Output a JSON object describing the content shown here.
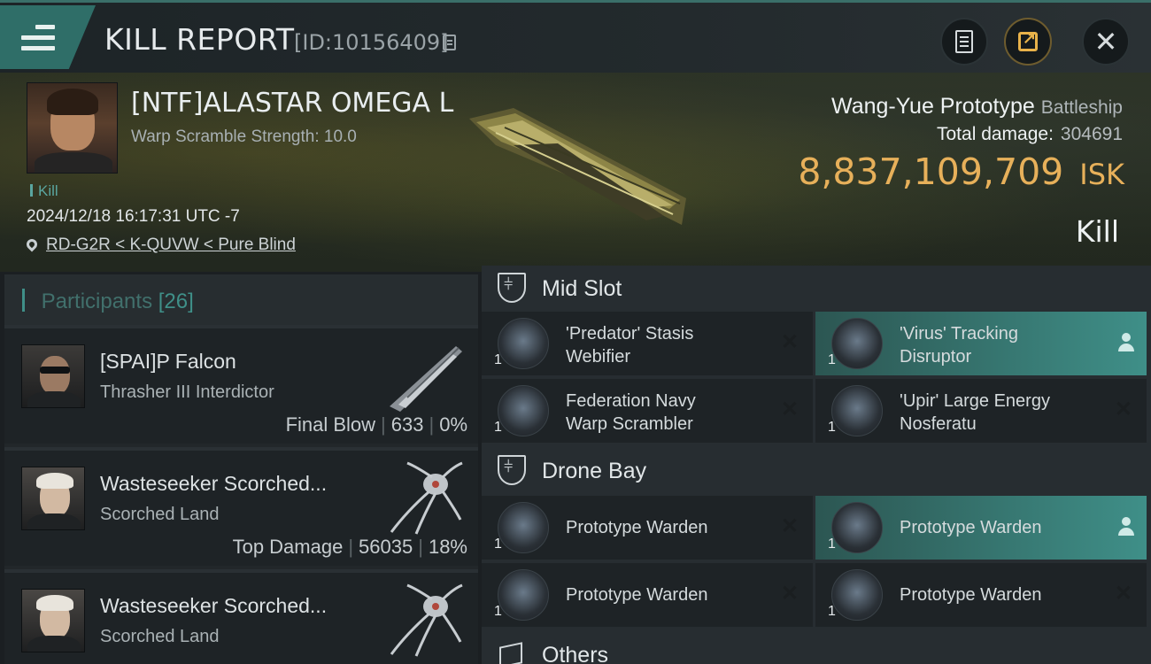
{
  "header": {
    "title": "KILL REPORT",
    "report_id": "[ID:10156409]"
  },
  "victim": {
    "name": "[NTF]ALASTAR OMEGA L",
    "warp_scramble": "Warp Scramble Strength: 10.0",
    "kill_tag": "Kill",
    "timestamp": "2024/12/18 16:17:31 UTC -7",
    "location": "RD-G2R < K-QUVW < Pure Blind",
    "ship_name": "Wang-Yue Prototype",
    "ship_class": "Battleship",
    "total_damage_label": "Total damage:",
    "total_damage": "304691",
    "isk_value": "8,837,109,709",
    "isk_unit": "ISK",
    "result": "Kill"
  },
  "participants": {
    "label": "Participants",
    "count": "[26]",
    "rows": [
      {
        "name": "[SPAI]P Falcon",
        "ship": "Thrasher III Interdictor",
        "tag": "Final Blow",
        "damage": "633",
        "percent": "0%"
      },
      {
        "name": "Wasteseeker Scorched...",
        "ship": "Scorched Land",
        "tag": "Top Damage",
        "damage": "56035",
        "percent": "18%"
      },
      {
        "name": "Wasteseeker Scorched...",
        "ship": "Scorched Land"
      }
    ]
  },
  "fitting": {
    "mid_slot_label": "Mid Slot",
    "drone_bay_label": "Drone Bay",
    "others_label": "Others",
    "mid_slots": [
      {
        "qty": "1",
        "line1": "'Predator' Stasis",
        "line2": "Webifier",
        "state": "destroyed"
      },
      {
        "qty": "1",
        "line1": "'Virus' Tracking",
        "line2": "Disruptor",
        "state": "dropped"
      },
      {
        "qty": "1",
        "line1": "Federation Navy",
        "line2": "Warp Scrambler",
        "state": "destroyed"
      },
      {
        "qty": "1",
        "line1": "'Upir' Large Energy",
        "line2": "Nosferatu",
        "state": "destroyed"
      }
    ],
    "drones": [
      {
        "qty": "1",
        "name": "Prototype  Warden",
        "state": "destroyed"
      },
      {
        "qty": "1",
        "name": "Prototype  Warden",
        "state": "dropped"
      },
      {
        "qty": "1",
        "name": "Prototype  Warden",
        "state": "destroyed"
      },
      {
        "qty": "1",
        "name": "Prototype  Warden",
        "state": "destroyed"
      }
    ],
    "close_glyph": "✕"
  },
  "colors": {
    "accent": "#3f8f88",
    "isk": "#e7b05a"
  }
}
